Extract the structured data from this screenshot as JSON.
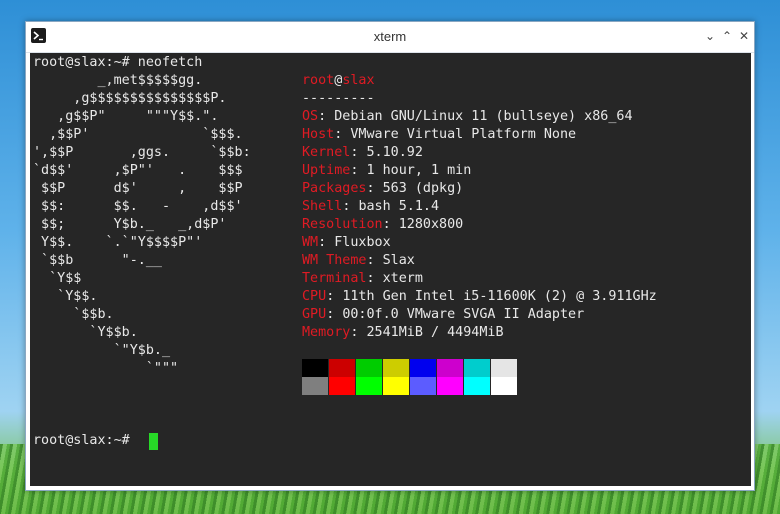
{
  "window": {
    "title": "xterm"
  },
  "controls": {
    "minimize": "⌄",
    "maximize": "⌃",
    "close": "✕"
  },
  "terminal": {
    "command_line": "root@slax:~# neofetch",
    "prompt": "root@slax:~# ",
    "logo": [
      "        _,met$$$$$gg.",
      "     ,g$$$$$$$$$$$$$$$P.",
      "   ,g$$P\"     \"\"\"Y$$.\".",
      "  ,$$P'              `$$$.",
      "',$$P       ,ggs.     `$$b:",
      "`d$$'     ,$P\"'   .    $$$",
      " $$P      d$'     ,    $$P",
      " $$:      $$.   -    ,d$$'",
      " $$;      Y$b._   _,d$P'",
      " Y$$.    `.`\"Y$$$$P\"'",
      " `$$b      \"-.__",
      "  `Y$$",
      "   `Y$$.",
      "     `$$b.",
      "       `Y$$b.",
      "          `\"Y$b._",
      "              `\"\"\""
    ],
    "user": "root",
    "at": "@",
    "host": "slax",
    "separator": "---------",
    "info": [
      {
        "key": "OS",
        "value": "Debian GNU/Linux 11 (bullseye) x86_64"
      },
      {
        "key": "Host",
        "value": "VMware Virtual Platform None"
      },
      {
        "key": "Kernel",
        "value": "5.10.92"
      },
      {
        "key": "Uptime",
        "value": "1 hour, 1 min"
      },
      {
        "key": "Packages",
        "value": "563 (dpkg)"
      },
      {
        "key": "Shell",
        "value": "bash 5.1.4"
      },
      {
        "key": "Resolution",
        "value": "1280x800"
      },
      {
        "key": "WM",
        "value": "Fluxbox"
      },
      {
        "key": "WM Theme",
        "value": "Slax"
      },
      {
        "key": "Terminal",
        "value": "xterm"
      },
      {
        "key": "CPU",
        "value": "11th Gen Intel i5-11600K (2) @ 3.911GHz"
      },
      {
        "key": "GPU",
        "value": "00:0f.0 VMware SVGA II Adapter"
      },
      {
        "key": "Memory",
        "value": "2541MiB / 4494MiB"
      }
    ],
    "palette_dark": [
      "#000000",
      "#cc0000",
      "#00cc00",
      "#cdcd00",
      "#0000ee",
      "#cd00cd",
      "#00cdcd",
      "#e5e5e5"
    ],
    "palette_bright": [
      "#7f7f7f",
      "#ff0000",
      "#00ff00",
      "#ffff00",
      "#5c5cff",
      "#ff00ff",
      "#00ffff",
      "#ffffff"
    ],
    "cursor_color": "#27d827"
  }
}
